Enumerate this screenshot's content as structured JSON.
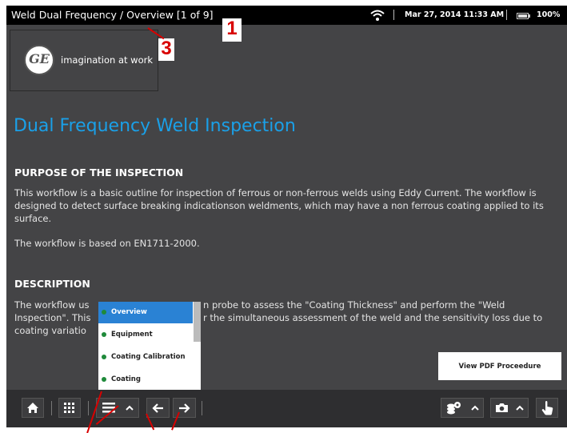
{
  "status_bar": {
    "title": "Weld Dual Frequency  / Overview  [1 of 9]",
    "datetime": "Mar 27, 2014 11:33 AM",
    "battery": "100%"
  },
  "callouts": [
    "1",
    "3"
  ],
  "logo": {
    "monogram": "GE",
    "tagline": "imagination at work"
  },
  "document": {
    "title": "Dual Frequency Weld Inspection",
    "purpose_heading": "PURPOSE OF THE INSPECTION",
    "purpose_p1": "This workflow is a basic outline for inspection of ferrous or non-ferrous welds using Eddy Current. The workflow is designed to detect surface breaking indicationson weldments, which may have a non ferrous coating applied to its surface.",
    "purpose_p2": "The workflow is based on EN1711-2000.",
    "description_heading": "DESCRIPTION",
    "description_fragments": {
      "line1_left": "The workflow us",
      "line1_right": "n probe to assess the \"Coating Thickness\" and perform the \"Weld",
      "line2_left": "Inspection\". This",
      "line2_right": "r the simultaneous assessment of the weld and the sensitivity loss due to",
      "line3_left": "coating variatio"
    }
  },
  "pdf_button": "View PDF Proceedure",
  "workflow_menu": {
    "items": [
      "Overview",
      "Equipment",
      "Coating Calibration",
      "Coating Measurement"
    ],
    "selected": "Overview"
  },
  "toolbar": {
    "left": [
      "home-icon",
      "grid-icon",
      "menu-icon",
      "chevron-up-icon",
      "arrow-left-icon",
      "arrow-right-icon"
    ],
    "right": [
      "settings-icon",
      "chevron-up-icon",
      "camera-icon",
      "chevron-up-icon",
      "touch-hand-icon"
    ]
  },
  "colors": {
    "background": "#444446",
    "status_bar": "#000000",
    "title_blue": "#1aa0e8",
    "menu_selected": "#2a82d4",
    "menu_dot": "#1f8a3a",
    "callout_red": "#d80000"
  }
}
